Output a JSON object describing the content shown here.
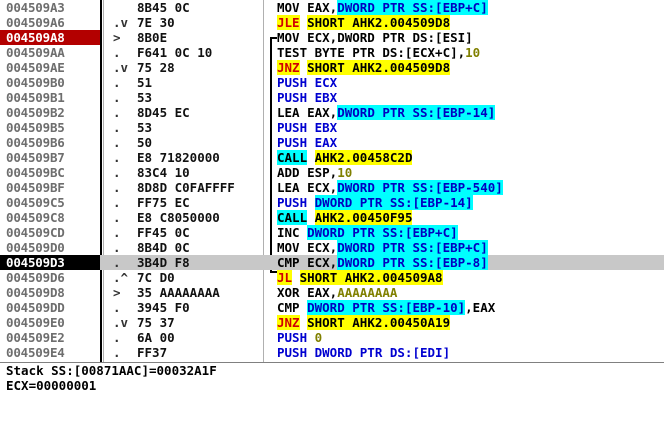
{
  "rows": [
    {
      "addr": "004509A3",
      "mark": "",
      "hex": "8B45 0C",
      "state": "",
      "asm": [
        {
          "t": "MOV EAX,",
          "c": ""
        },
        {
          "t": "DWORD PTR SS:[EBP+C]",
          "c": "hl-mem"
        }
      ]
    },
    {
      "addr": "004509A6",
      "mark": ".v",
      "hex": "7E 30",
      "state": "",
      "asm": [
        {
          "t": "JLE",
          "c": "op-jcc"
        },
        {
          "t": " ",
          "c": ""
        },
        {
          "t": "SHORT AHK2.004509D8",
          "c": "tgt-y"
        }
      ]
    },
    {
      "addr": "004509A8",
      "mark": ">",
      "hex": "8B0E",
      "state": "sel",
      "asm": [
        {
          "t": "MOV ECX,DWORD PTR DS:[ESI]",
          "c": ""
        }
      ]
    },
    {
      "addr": "004509AA",
      "mark": ".",
      "hex": "F641 0C 10",
      "state": "",
      "asm": [
        {
          "t": "TEST BYTE PTR DS:[ECX+C],",
          "c": ""
        },
        {
          "t": "10",
          "c": "num"
        }
      ]
    },
    {
      "addr": "004509AE",
      "mark": ".v",
      "hex": "75 28",
      "state": "",
      "asm": [
        {
          "t": "JNZ",
          "c": "op-jcc"
        },
        {
          "t": " ",
          "c": ""
        },
        {
          "t": "SHORT AHK2.004509D8",
          "c": "tgt-y"
        }
      ]
    },
    {
      "addr": "004509B0",
      "mark": ".",
      "hex": "51",
      "state": "",
      "asm": [
        {
          "t": "PUSH ECX",
          "c": "op-push"
        }
      ]
    },
    {
      "addr": "004509B1",
      "mark": ".",
      "hex": "53",
      "state": "",
      "asm": [
        {
          "t": "PUSH EBX",
          "c": "op-push"
        }
      ]
    },
    {
      "addr": "004509B2",
      "mark": ".",
      "hex": "8D45 EC",
      "state": "",
      "asm": [
        {
          "t": "LEA EAX,",
          "c": ""
        },
        {
          "t": "DWORD PTR SS:[EBP-14]",
          "c": "hl-mem"
        }
      ]
    },
    {
      "addr": "004509B5",
      "mark": ".",
      "hex": "53",
      "state": "",
      "asm": [
        {
          "t": "PUSH EBX",
          "c": "op-push"
        }
      ]
    },
    {
      "addr": "004509B6",
      "mark": ".",
      "hex": "50",
      "state": "",
      "asm": [
        {
          "t": "PUSH EAX",
          "c": "op-push"
        }
      ]
    },
    {
      "addr": "004509B7",
      "mark": ".",
      "hex": "E8 71820000",
      "state": "",
      "asm": [
        {
          "t": "CALL",
          "c": "op-call"
        },
        {
          "t": " ",
          "c": ""
        },
        {
          "t": "AHK2.00458C2D",
          "c": "tgt-y"
        }
      ]
    },
    {
      "addr": "004509BC",
      "mark": ".",
      "hex": "83C4 10",
      "state": "",
      "asm": [
        {
          "t": "ADD ESP,",
          "c": ""
        },
        {
          "t": "10",
          "c": "num"
        }
      ]
    },
    {
      "addr": "004509BF",
      "mark": ".",
      "hex": "8D8D C0FAFFFF",
      "state": "",
      "asm": [
        {
          "t": "LEA ECX,",
          "c": ""
        },
        {
          "t": "DWORD PTR SS:[EBP-540]",
          "c": "hl-mem"
        }
      ]
    },
    {
      "addr": "004509C5",
      "mark": ".",
      "hex": "FF75 EC",
      "state": "",
      "asm": [
        {
          "t": "PUSH ",
          "c": "op-push"
        },
        {
          "t": "DWORD PTR SS:[EBP-14]",
          "c": "hl-mem"
        }
      ]
    },
    {
      "addr": "004509C8",
      "mark": ".",
      "hex": "E8 C8050000",
      "state": "",
      "asm": [
        {
          "t": "CALL",
          "c": "op-call"
        },
        {
          "t": " ",
          "c": ""
        },
        {
          "t": "AHK2.00450F95",
          "c": "tgt-y"
        }
      ]
    },
    {
      "addr": "004509CD",
      "mark": ".",
      "hex": "FF45 0C",
      "state": "",
      "asm": [
        {
          "t": "INC ",
          "c": ""
        },
        {
          "t": "DWORD PTR SS:[EBP+C]",
          "c": "hl-mem"
        }
      ]
    },
    {
      "addr": "004509D0",
      "mark": ".",
      "hex": "8B4D 0C",
      "state": "",
      "asm": [
        {
          "t": "MOV ECX,",
          "c": ""
        },
        {
          "t": "DWORD PTR SS:[EBP+C]",
          "c": "hl-mem"
        }
      ]
    },
    {
      "addr": "004509D3",
      "mark": ".",
      "hex": "3B4D F8",
      "state": "cur",
      "asm": [
        {
          "t": "CMP ECX,",
          "c": ""
        },
        {
          "t": "DWORD PTR SS:[EBP-8]",
          "c": "hl-mem"
        }
      ]
    },
    {
      "addr": "004509D6",
      "mark": ".^",
      "hex": "7C D0",
      "state": "",
      "asm": [
        {
          "t": "JL",
          "c": "op-jcc"
        },
        {
          "t": " ",
          "c": ""
        },
        {
          "t": "SHORT AHK2.004509A8",
          "c": "tgt-y"
        }
      ]
    },
    {
      "addr": "004509D8",
      "mark": ">",
      "hex": "35 AAAAAAAA",
      "state": "",
      "asm": [
        {
          "t": "XOR EAX,",
          "c": ""
        },
        {
          "t": "AAAAAAAA",
          "c": "num"
        }
      ]
    },
    {
      "addr": "004509DD",
      "mark": ".",
      "hex": "3945 F0",
      "state": "",
      "asm": [
        {
          "t": "CMP ",
          "c": ""
        },
        {
          "t": "DWORD PTR SS:[EBP-10]",
          "c": "hl-mem"
        },
        {
          "t": ",EAX",
          "c": ""
        }
      ]
    },
    {
      "addr": "004509E0",
      "mark": ".v",
      "hex": "75 37",
      "state": "",
      "asm": [
        {
          "t": "JNZ",
          "c": "op-jcc"
        },
        {
          "t": " ",
          "c": ""
        },
        {
          "t": "SHORT AHK2.00450A19",
          "c": "tgt-y"
        }
      ]
    },
    {
      "addr": "004509E2",
      "mark": ".",
      "hex": "6A 00",
      "state": "",
      "asm": [
        {
          "t": "PUSH ",
          "c": "op-push"
        },
        {
          "t": "0",
          "c": "num"
        }
      ]
    },
    {
      "addr": "004509E4",
      "mark": ".",
      "hex": "FF37",
      "state": "",
      "asm": [
        {
          "t": "PUSH DWORD PTR DS:[EDI]",
          "c": "op-push"
        }
      ]
    }
  ],
  "info": {
    "line1": "Stack SS:[00871AAC]=00032A1F",
    "line2": "ECX=00000001"
  }
}
